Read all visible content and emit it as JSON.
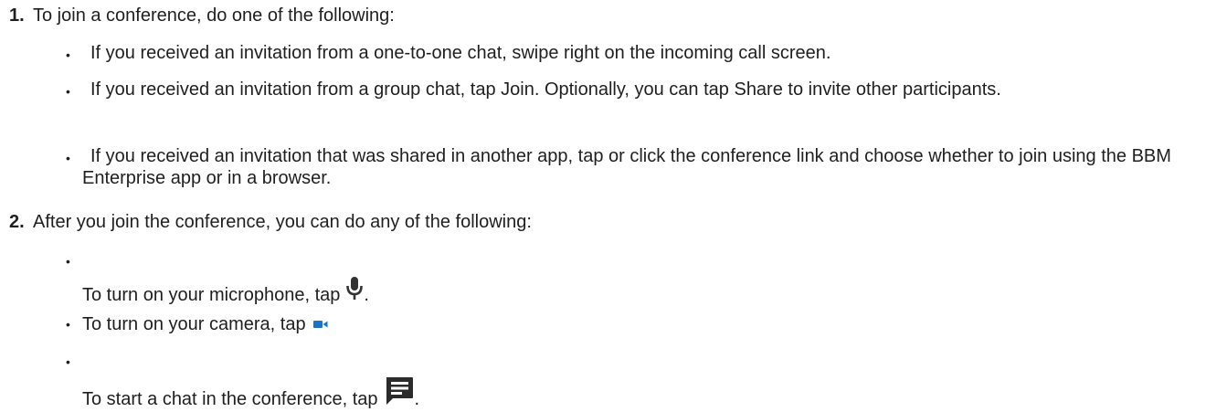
{
  "steps": [
    {
      "number": "1.",
      "text": "To join a conference, do one of the following:",
      "items": [
        "If you received an invitation from a one-to-one chat, swipe right on the incoming call screen.",
        "If you received an invitation from a group chat, tap Join. Optionally, you can tap Share to invite other participants.",
        "If you received an invitation that was shared in another app, tap or click the conference link and choose whether to join using the BBM Enterprise app or in a browser."
      ]
    },
    {
      "number": "2.",
      "text": "After you join the conference, you can do any of the following:",
      "items": [
        {
          "text": "To  turn on your microphone, tap",
          "icon": "microphone-icon",
          "suffix": "."
        },
        {
          "text": "To turn on your camera, tap",
          "icon": "video-camera-icon",
          "suffix": ""
        },
        {
          "text": "To start a chat in the conference, tap",
          "icon": "chat-message-icon",
          "suffix": "."
        }
      ]
    }
  ],
  "bullet_char": "•",
  "colors": {
    "text": "#1f1f1f",
    "camera_icon": "#1a73c8",
    "icon_dark": "#333333"
  }
}
